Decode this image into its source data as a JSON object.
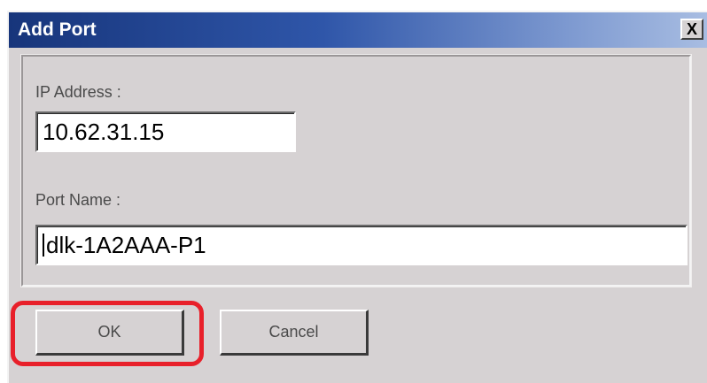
{
  "dialog": {
    "title": "Add Port",
    "close_label": "X"
  },
  "form": {
    "ip_label": "IP Address :",
    "ip_value": "10.62.31.15",
    "port_label": "Port Name :",
    "port_value": "dlk-1A2AAA-P1"
  },
  "buttons": {
    "ok_label": "OK",
    "cancel_label": "Cancel"
  },
  "colors": {
    "highlight": "#e8202a",
    "titlebar": "#17357b"
  }
}
